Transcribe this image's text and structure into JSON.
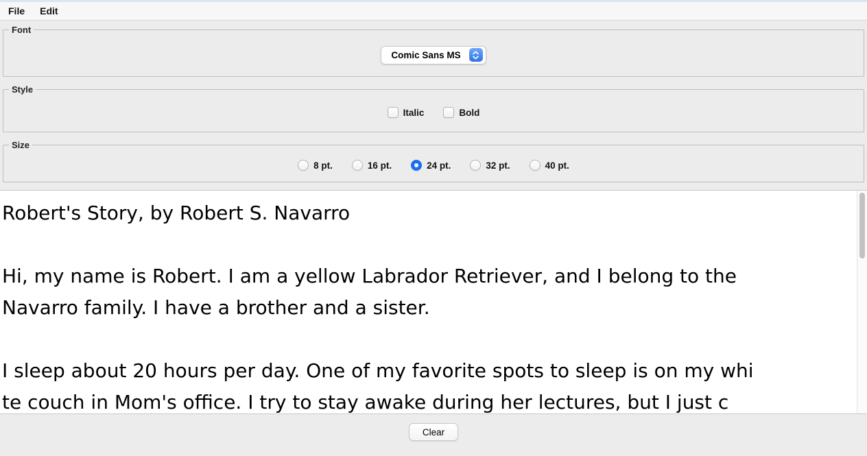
{
  "menu": {
    "items": [
      {
        "label": "File"
      },
      {
        "label": "Edit"
      }
    ]
  },
  "font_group": {
    "title": "Font",
    "dropdown": {
      "selected": "Comic Sans MS"
    }
  },
  "style_group": {
    "title": "Style",
    "checkboxes": [
      {
        "label": "Italic",
        "checked": false
      },
      {
        "label": "Bold",
        "checked": false
      }
    ]
  },
  "size_group": {
    "title": "Size",
    "options": [
      {
        "label": "8 pt.",
        "selected": false
      },
      {
        "label": "16 pt.",
        "selected": false
      },
      {
        "label": "24 pt.",
        "selected": true
      },
      {
        "label": "32 pt.",
        "selected": false
      },
      {
        "label": "40 pt.",
        "selected": false
      }
    ]
  },
  "editor": {
    "lines": [
      "Robert's Story, by Robert S. Navarro",
      "",
      "Hi, my name is Robert. I am a yellow Labrador Retriever, and I belong to the",
      "Navarro family. I have a brother and a sister.",
      "",
      "I sleep about 20 hours per day. One of my favorite spots to sleep is on my whi",
      "te couch in Mom's office. I try to stay awake during her lectures, but I just c"
    ]
  },
  "footer": {
    "clear_label": "Clear"
  },
  "colors": {
    "accent_blue": "#2e72e8",
    "accent_blue_light": "#6fa9f8",
    "radio_selected": "#1b6ef3",
    "panel_bg": "#ececec",
    "menubar_bg": "#f7f7f7",
    "textarea_bg": "#ffffff",
    "group_border": "#bdbdbd",
    "top_strip": "#d8e6f4"
  }
}
